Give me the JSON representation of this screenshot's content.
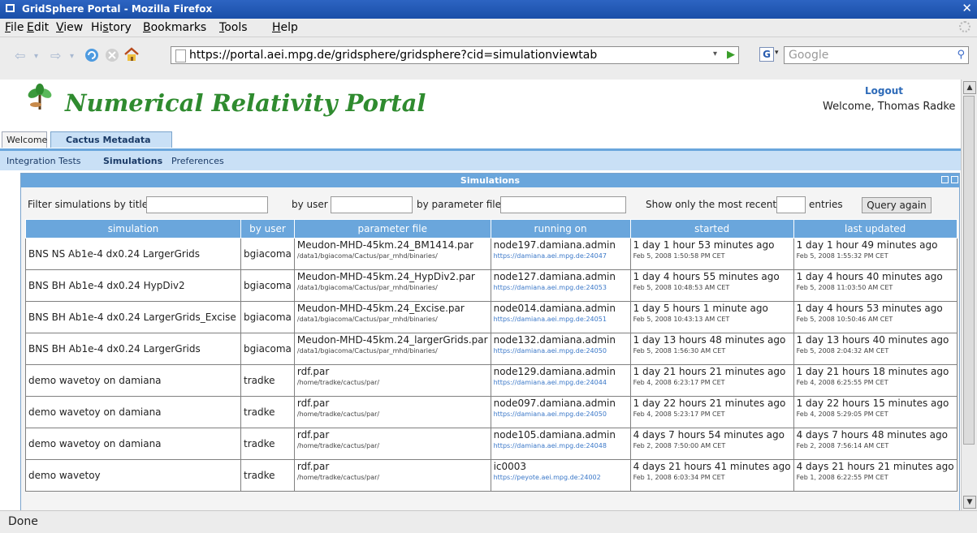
{
  "window": {
    "title": "GridSphere Portal - Mozilla Firefox",
    "close_glyph": "✕"
  },
  "menu": [
    {
      "key": "F",
      "rest": "ile"
    },
    {
      "key": "E",
      "rest": "dit"
    },
    {
      "key": "V",
      "rest": "iew"
    },
    {
      "pre": "Hi",
      "key": "s",
      "rest": "tory"
    },
    {
      "key": "B",
      "rest": "ookmarks"
    },
    {
      "key": "T",
      "rest": "ools"
    },
    {
      "key": "H",
      "rest": "elp"
    }
  ],
  "nav": {
    "url": "https://portal.aei.mpg.de/gridsphere/gridsphere?cid=simulationviewtab",
    "search_placeholder": "Google"
  },
  "portal": {
    "title": "Numerical Relativity Portal",
    "logout": "Logout",
    "welcome": "Welcome, Thomas Radke"
  },
  "tabs": [
    {
      "label": "Welcome",
      "active": false
    },
    {
      "label": "Cactus Metadata",
      "active": true
    }
  ],
  "subnav": [
    "Integration Tests",
    "Simulations",
    "Preferences"
  ],
  "subnav_active": "Simulations",
  "panel": {
    "title": "Simulations"
  },
  "filter": {
    "title_label": "Filter simulations by title",
    "user_label": "by user",
    "param_label": "by parameter file",
    "recent_label": "Show only the most recent",
    "entries_label": "entries",
    "query_button": "Query again"
  },
  "table": {
    "headers": [
      "simulation",
      "by user",
      "parameter file",
      "running on",
      "started",
      "last updated"
    ],
    "rows": [
      {
        "simulation": "BNS NS Ab1e-4 dx0.24 LargerGrids",
        "user": "bgiacoma",
        "param": "Meudon-MHD-45km.24_BM1414.par",
        "param_path": "/data1/bgiacoma/Cactus/par_mhd/binaries/",
        "host": "node197.damiana.admin",
        "host_url": "https://damiana.aei.mpg.de:24047",
        "started": "1 day 1 hour 53 minutes ago",
        "started_date": "Feb 5, 2008 1:50:58 PM CET",
        "updated": "1 day 1 hour 49 minutes ago",
        "updated_date": "Feb 5, 2008 1:55:32 PM CET"
      },
      {
        "simulation": "BNS BH Ab1e-4 dx0.24 HypDiv2",
        "user": "bgiacoma",
        "param": "Meudon-MHD-45km.24_HypDiv2.par",
        "param_path": "/data1/bgiacoma/Cactus/par_mhd/binaries/",
        "host": "node127.damiana.admin",
        "host_url": "https://damiana.aei.mpg.de:24053",
        "started": "1 day 4 hours 55 minutes ago",
        "started_date": "Feb 5, 2008 10:48:53 AM CET",
        "updated": "1 day 4 hours 40 minutes ago",
        "updated_date": "Feb 5, 2008 11:03:50 AM CET"
      },
      {
        "simulation": "BNS BH Ab1e-4 dx0.24 LargerGrids_Excise",
        "user": "bgiacoma",
        "param": "Meudon-MHD-45km.24_Excise.par",
        "param_path": "/data1/bgiacoma/Cactus/par_mhd/binaries/",
        "host": "node014.damiana.admin",
        "host_url": "https://damiana.aei.mpg.de:24051",
        "started": "1 day 5 hours 1 minute ago",
        "started_date": "Feb 5, 2008 10:43:13 AM CET",
        "updated": "1 day 4 hours 53 minutes ago",
        "updated_date": "Feb 5, 2008 10:50:46 AM CET"
      },
      {
        "simulation": "BNS BH Ab1e-4 dx0.24 LargerGrids",
        "user": "bgiacoma",
        "param": "Meudon-MHD-45km.24_largerGrids.par",
        "param_path": "/data1/bgiacoma/Cactus/par_mhd/binaries/",
        "host": "node132.damiana.admin",
        "host_url": "https://damiana.aei.mpg.de:24050",
        "started": "1 day 13 hours 48 minutes ago",
        "started_date": "Feb 5, 2008 1:56:30 AM CET",
        "updated": "1 day 13 hours 40 minutes ago",
        "updated_date": "Feb 5, 2008 2:04:32 AM CET"
      },
      {
        "simulation": "demo wavetoy on damiana",
        "user": "tradke",
        "param": "rdf.par",
        "param_path": "/home/tradke/cactus/par/",
        "host": "node129.damiana.admin",
        "host_url": "https://damiana.aei.mpg.de:24044",
        "started": "1 day 21 hours 21 minutes ago",
        "started_date": "Feb 4, 2008 6:23:17 PM CET",
        "updated": "1 day 21 hours 18 minutes ago",
        "updated_date": "Feb 4, 2008 6:25:55 PM CET"
      },
      {
        "simulation": "demo wavetoy on damiana",
        "user": "tradke",
        "param": "rdf.par",
        "param_path": "/home/tradke/cactus/par/",
        "host": "node097.damiana.admin",
        "host_url": "https://damiana.aei.mpg.de:24050",
        "started": "1 day 22 hours 21 minutes ago",
        "started_date": "Feb 4, 2008 5:23:17 PM CET",
        "updated": "1 day 22 hours 15 minutes ago",
        "updated_date": "Feb 4, 2008 5:29:05 PM CET"
      },
      {
        "simulation": "demo wavetoy on damiana",
        "user": "tradke",
        "param": "rdf.par",
        "param_path": "/home/tradke/cactus/par/",
        "host": "node105.damiana.admin",
        "host_url": "https://damiana.aei.mpg.de:24048",
        "started": "4 days 7 hours 54 minutes ago",
        "started_date": "Feb 2, 2008 7:50:00 AM CET",
        "updated": "4 days 7 hours 48 minutes ago",
        "updated_date": "Feb 2, 2008 7:56:14 AM CET"
      },
      {
        "simulation": "demo wavetoy",
        "user": "tradke",
        "param": "rdf.par",
        "param_path": "/home/tradke/cactus/par/",
        "host": "ic0003",
        "host_url": "https://peyote.aei.mpg.de:24002",
        "started": "4 days 21 hours 41 minutes ago",
        "started_date": "Feb 1, 2008 6:03:34 PM CET",
        "updated": "4 days 21 hours 21 minutes ago",
        "updated_date": "Feb 1, 2008 6:22:55 PM CET"
      }
    ]
  },
  "status": "Done",
  "colors": {
    "accent": "#6aa6dc",
    "title_green": "#2f8b2f",
    "link": "#3b78c8",
    "titlebar": "#2d64c2"
  }
}
